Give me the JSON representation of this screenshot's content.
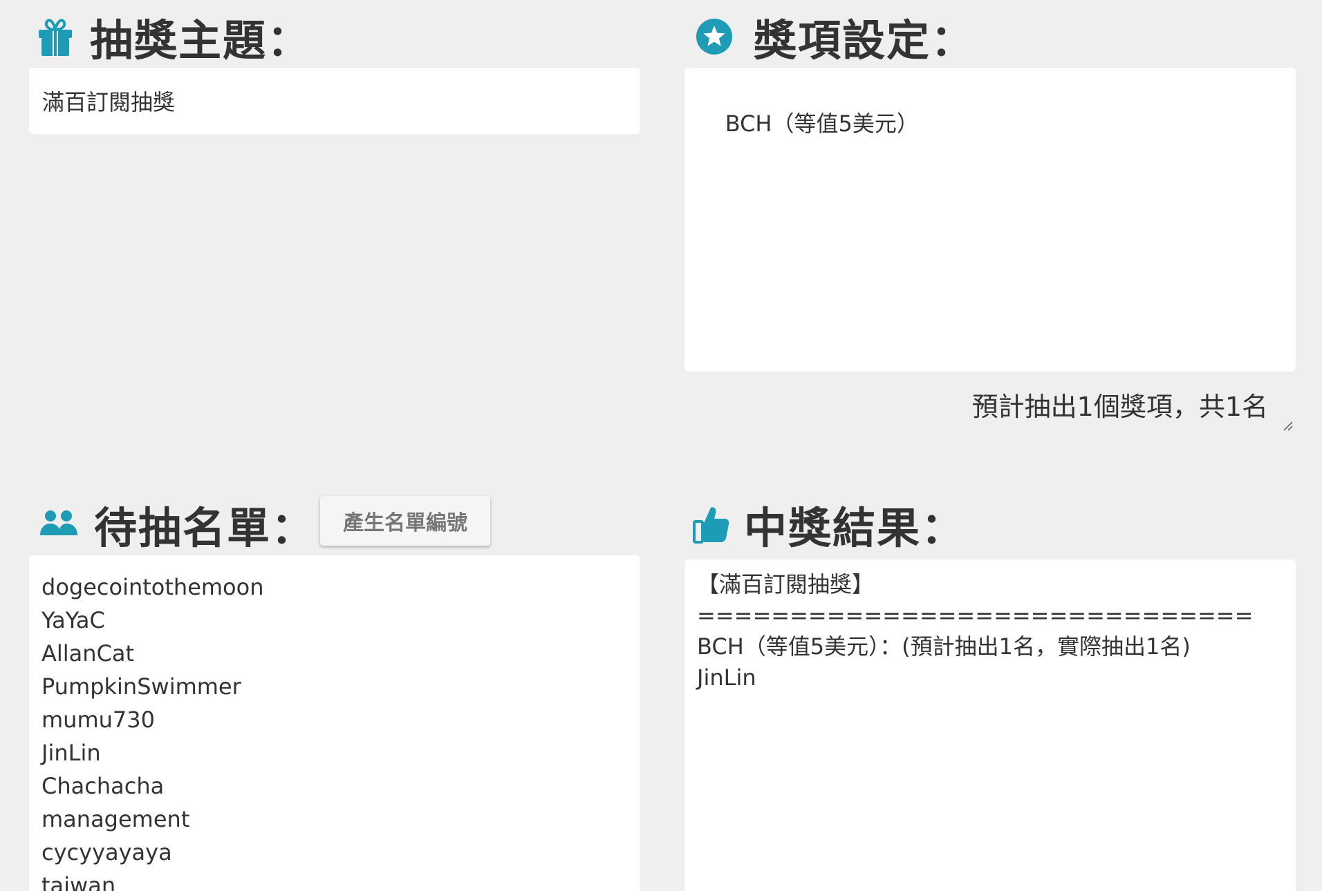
{
  "theme": {
    "title": "抽獎主題：",
    "icon": "gift-icon",
    "value": "滿百訂閱抽獎"
  },
  "prizes": {
    "title": "獎項設定：",
    "icon": "star-circle-icon",
    "value": "BCH（等值5美元）",
    "summary": "預計抽出1個獎項，共1名"
  },
  "candidates": {
    "title": "待抽名單：",
    "icon": "users-icon",
    "generate_button_label": "產生名單編號",
    "names": [
      "dogecointothemoon",
      "YaYaC",
      "AllanCat",
      "PumpkinSwimmer",
      "mumu730",
      "JinLin",
      "Chachacha",
      "management",
      "cycyyayaya",
      "taiwan"
    ]
  },
  "results": {
    "title": "中獎結果：",
    "icon": "thumbs-up-icon",
    "lines": [
      "【滿百訂閱抽獎】",
      "==============================",
      "BCH（等值5美元）：(預計抽出1名，實際抽出1名)",
      "JinLin"
    ]
  },
  "colors": {
    "icon_accent": "#1e9bb5",
    "background": "#efefef",
    "panel": "#ffffff",
    "text": "#333333"
  }
}
